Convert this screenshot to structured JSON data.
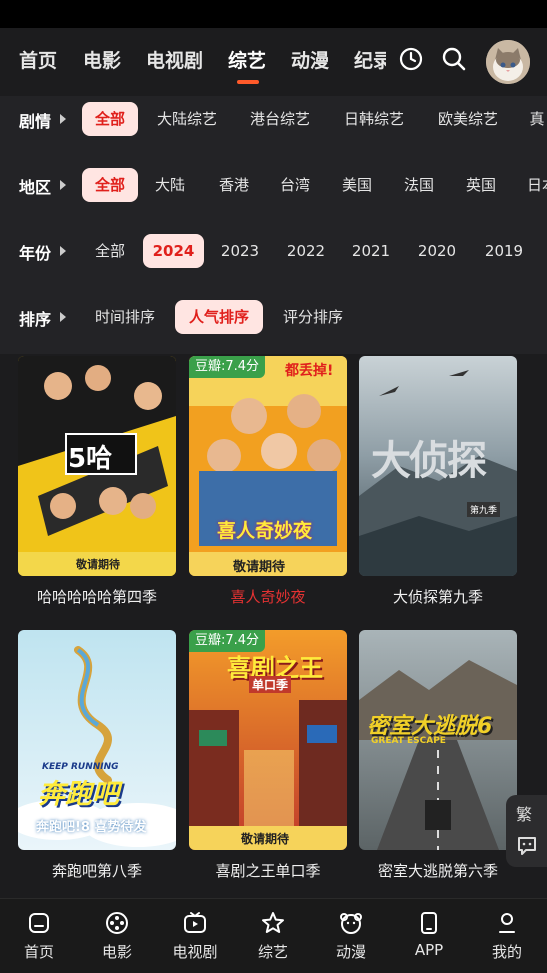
{
  "top_tabs": [
    {
      "label": "首页"
    },
    {
      "label": "电影"
    },
    {
      "label": "电视剧"
    },
    {
      "label": "综艺"
    },
    {
      "label": "动漫"
    },
    {
      "label": "纪录"
    }
  ],
  "active_tab_index": 3,
  "filters": [
    {
      "label": "剧情",
      "options": [
        "全部",
        "大陆综艺",
        "港台综艺",
        "日韩综艺",
        "欧美综艺",
        "真"
      ],
      "selected": 0
    },
    {
      "label": "地区",
      "options": [
        "全部",
        "大陆",
        "香港",
        "台湾",
        "美国",
        "法国",
        "英国",
        "日本"
      ],
      "selected": 0
    },
    {
      "label": "年份",
      "options": [
        "全部",
        "2024",
        "2023",
        "2022",
        "2021",
        "2020",
        "2019"
      ],
      "selected": 1
    },
    {
      "label": "排序",
      "options": [
        "时间排序",
        "人气排序",
        "评分排序"
      ],
      "selected": 1
    }
  ],
  "cards": [
    {
      "title": "哈哈哈哈哈第四季",
      "score": "",
      "poster_text": "5哈",
      "poster_sub": "敬请期待",
      "highlight": false
    },
    {
      "title": "喜人奇妙夜",
      "score": "豆瓣:7.4分",
      "poster_text": "喜人奇妙夜",
      "poster_sub": "敬请期待",
      "poster_top": "都丢掉!",
      "highlight": true
    },
    {
      "title": "大侦探第九季",
      "score": "",
      "poster_text": "大侦探",
      "poster_sub": "第九季",
      "highlight": false
    },
    {
      "title": "奔跑吧第八季",
      "score": "",
      "poster_text": "奔跑吧",
      "poster_sub": "奔跑吧!8 喜势待发",
      "poster_top": "KEEP RUNNING",
      "highlight": false
    },
    {
      "title": "喜剧之王单口季",
      "score": "豆瓣:7.4分",
      "poster_text": "喜剧之王",
      "poster_sub": "敬请期待",
      "poster_top": "单口季",
      "highlight": false
    },
    {
      "title": "密室大逃脱第六季",
      "score": "",
      "poster_text": "密室大逃脱6",
      "poster_sub": "GREAT ESCAPE",
      "highlight": false
    }
  ],
  "side_tool": {
    "label": "繁"
  },
  "bottom_nav": [
    {
      "label": "首页",
      "icon": "home-icon"
    },
    {
      "label": "电影",
      "icon": "film-reel-icon"
    },
    {
      "label": "电视剧",
      "icon": "tv-icon"
    },
    {
      "label": "综艺",
      "icon": "star-icon"
    },
    {
      "label": "动漫",
      "icon": "bear-icon"
    },
    {
      "label": "APP",
      "icon": "phone-icon"
    },
    {
      "label": "我的",
      "icon": "user-icon"
    }
  ],
  "colors": {
    "accent": "#e0201c",
    "tab_underline": "#ff5a2a",
    "score_badge": "#3aa04a",
    "background": "#1c1c1e"
  }
}
